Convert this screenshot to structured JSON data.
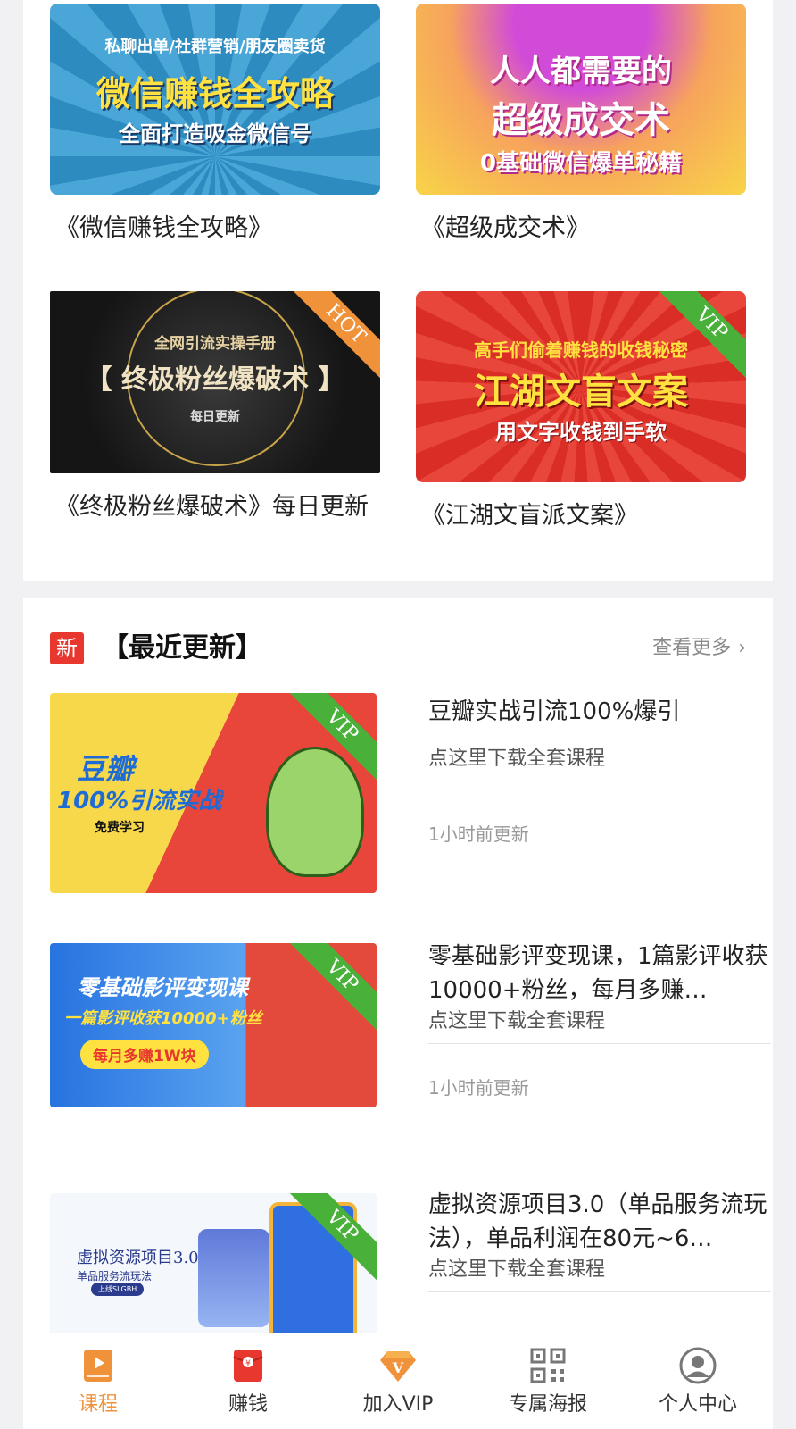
{
  "top_courses": [
    {
      "title": "《微信赚钱全攻略》",
      "banner": {
        "line1": "私聊出单/社群营销/朋友圈卖货",
        "line2": "微信赚钱全攻略",
        "line3": "全面打造吸金微信号"
      }
    },
    {
      "title": "《超级成交术》",
      "banner": {
        "line1": "人人都需要的",
        "line2": "超级成交术",
        "line3": "0基础微信爆单秘籍"
      }
    },
    {
      "title": "《终极粉丝爆破术》每日更新",
      "banner": {
        "line1": "全网引流实操手册",
        "line2": "【 终极粉丝爆破术 】",
        "line3": "每日更新"
      },
      "ribbon": "HOT"
    },
    {
      "title": "《江湖文盲派文案》",
      "banner": {
        "line1": "高手们偷着赚钱的收钱秘密",
        "line2": "江湖文盲文案",
        "line3": "用文字收钱到手软"
      },
      "ribbon": "VIP"
    }
  ],
  "recent": {
    "badge": "新",
    "title": "【最近更新】",
    "more": "查看更多",
    "items": [
      {
        "title": "豆瓣实战引流100%爆引",
        "download": "点这里下载全套课程",
        "time": "1小时前更新",
        "ribbon": "VIP",
        "banner": {
          "line1": "豆瓣",
          "line2": "100%引流实战",
          "line3": "免费学习"
        }
      },
      {
        "title": "零基础影评变现课，1篇影评收获10000+粉丝，每月多赚…",
        "download": "点这里下载全套课程",
        "time": "1小时前更新",
        "ribbon": "VIP",
        "banner": {
          "line1": "零基础影评变现课",
          "line2": "一篇影评收获10000+粉丝",
          "line3": "每月多赚1W块"
        }
      },
      {
        "title": "虚拟资源项目3.0（单品服务流玩法），单品利润在80元~6…",
        "download": "点这里下载全套课程",
        "time": "",
        "ribbon": "VIP",
        "banner": {
          "line1": "虚拟资源项目3.0",
          "line2": "单品服务流玩法",
          "line3": "上线SLGBH"
        }
      }
    ]
  },
  "tabbar": [
    {
      "label": "课程",
      "icon": "course-icon",
      "active": true
    },
    {
      "label": "赚钱",
      "icon": "red-envelope-icon",
      "active": false
    },
    {
      "label": "加入VIP",
      "icon": "vip-diamond-icon",
      "active": false
    },
    {
      "label": "专属海报",
      "icon": "qr-code-icon",
      "active": false
    },
    {
      "label": "个人中心",
      "icon": "user-icon",
      "active": false
    }
  ],
  "colors": {
    "accent": "#f0923a",
    "badge_red": "#e8372f",
    "vip_green": "#49b13a"
  }
}
